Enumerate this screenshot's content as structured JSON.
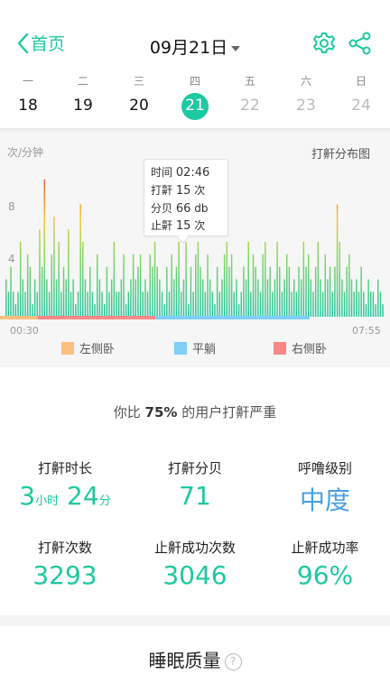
{
  "header": {
    "back_label": "首页",
    "date": "09月21日"
  },
  "week": [
    {
      "weekday": "一",
      "day": "18",
      "state": "past"
    },
    {
      "weekday": "二",
      "day": "19",
      "state": "past"
    },
    {
      "weekday": "三",
      "day": "20",
      "state": "past"
    },
    {
      "weekday": "四",
      "day": "21",
      "state": "selected"
    },
    {
      "weekday": "五",
      "day": "22",
      "state": "future"
    },
    {
      "weekday": "六",
      "day": "23",
      "state": "future"
    },
    {
      "weekday": "日",
      "day": "24",
      "state": "future"
    }
  ],
  "chart": {
    "ylabel": "次/分钟",
    "title": "打鼾分布图",
    "y_ticks": [
      "8",
      "4"
    ],
    "start_time": "00:30",
    "end_time": "07:55",
    "tooltip": {
      "time_label": "时间",
      "time": "02:46",
      "count_label": "打鼾",
      "count": "15",
      "count_unit": "次",
      "db_label": "分贝",
      "db": "66",
      "db_unit": "db",
      "stop_label": "止鼾",
      "stop": "15",
      "stop_unit": "次"
    },
    "legend": [
      {
        "label": "左侧卧",
        "color": "#fdbf80"
      },
      {
        "label": "平躺",
        "color": "#81cff5"
      },
      {
        "label": "右侧卧",
        "color": "#f98888"
      }
    ],
    "position_segments": [
      {
        "position": "左侧卧",
        "from": "00:30",
        "to": "00:55"
      },
      {
        "position": "右侧卧",
        "from": "00:55",
        "to": "02:26"
      },
      {
        "position": "平躺",
        "from": "02:26",
        "to": "06:55"
      }
    ]
  },
  "chart_data": {
    "type": "bar",
    "ylabel": "次/分钟",
    "title": "打鼾分布图",
    "ylim": [
      0,
      12
    ],
    "x_range": [
      "00:30",
      "07:55"
    ],
    "values": [
      3,
      2,
      4,
      2,
      1,
      2,
      6,
      3,
      2,
      5,
      4,
      1,
      3,
      2,
      7,
      4,
      11,
      3,
      2,
      5,
      8,
      3,
      6,
      2,
      4,
      3,
      7,
      2,
      3,
      1,
      2,
      9,
      6,
      3,
      2,
      4,
      2,
      1,
      5,
      3,
      2,
      1,
      4,
      2,
      3,
      6,
      2,
      2,
      3,
      5,
      1,
      2,
      3,
      5,
      3,
      4,
      5,
      2,
      3,
      2,
      5,
      4,
      6,
      4,
      3,
      2,
      1,
      4,
      2,
      5,
      3,
      4,
      6,
      2,
      3,
      6,
      1,
      4,
      2,
      5,
      6,
      4,
      3,
      2,
      5,
      3,
      2,
      1,
      4,
      2,
      3,
      5,
      6,
      4,
      5,
      2,
      3,
      1,
      2,
      4,
      3,
      6,
      2,
      5,
      4,
      3,
      2,
      5,
      6,
      3,
      4,
      2,
      3,
      6,
      4,
      2,
      3,
      5,
      4,
      2,
      3,
      2,
      4,
      3,
      6,
      4,
      5,
      3,
      2,
      4,
      6,
      3,
      2,
      5,
      3,
      4,
      2,
      4,
      9,
      6,
      3,
      2,
      4,
      5,
      3,
      2,
      3,
      2,
      4,
      2,
      1,
      3,
      2,
      2,
      1,
      3,
      2,
      1
    ]
  },
  "comparison": {
    "prefix": "你比",
    "percent": "75%",
    "suffix": "的用户打鼾严重"
  },
  "stats": {
    "duration_label": "打鼾时长",
    "duration_hours": "3",
    "hours_unit": "小时",
    "duration_minutes": "24",
    "minutes_unit": "分",
    "db_label": "打鼾分贝",
    "db_value": "71",
    "level_label": "呼噜级别",
    "level_value": "中度",
    "count_label": "打鼾次数",
    "count_value": "3293",
    "stop_label": "止鼾成功次数",
    "stop_value": "3046",
    "rate_label": "止鼾成功率",
    "rate_value": "96%"
  },
  "sleep_quality": {
    "title": "睡眠质量",
    "help": "?"
  },
  "colors": {
    "accent": "#1dc9a0",
    "level": "#4a9fe0"
  }
}
